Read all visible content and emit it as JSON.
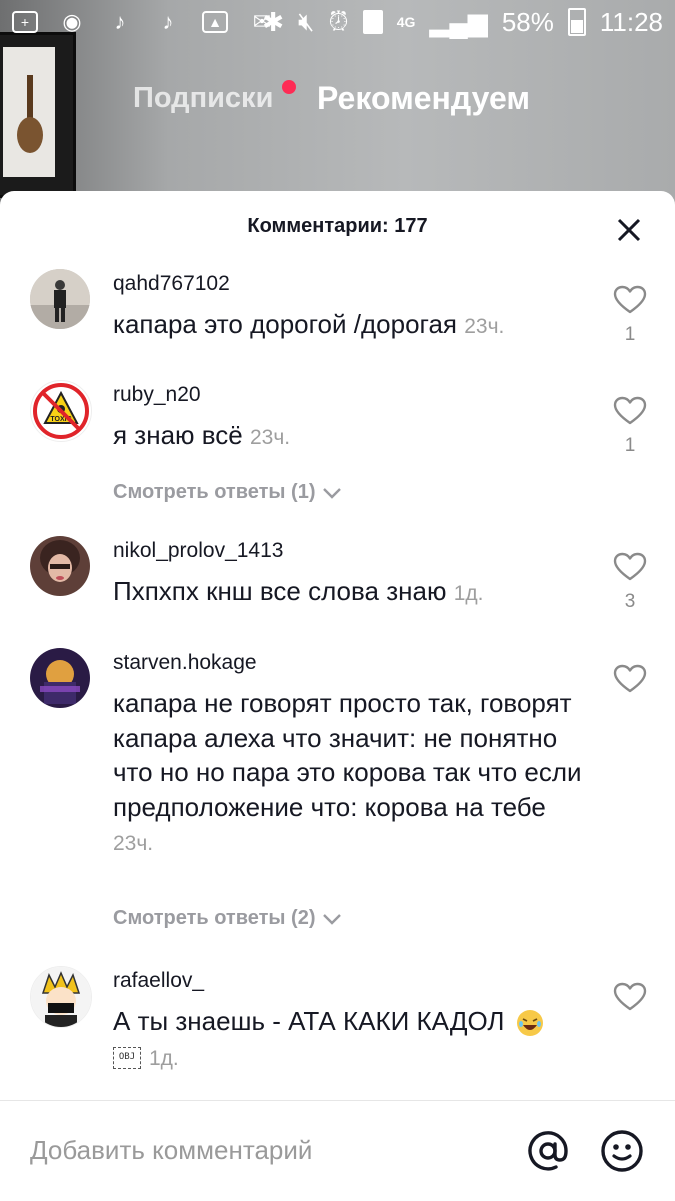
{
  "status_bar": {
    "network": "4G",
    "battery_percent": "58%",
    "time": "11:28",
    "sim_slot": "1"
  },
  "top_tabs": {
    "following": "Подписки",
    "for_you": "Рекомендуем"
  },
  "comments_panel": {
    "title": "Комментарии: 177",
    "input_placeholder": "Добавить комментарий",
    "comments": [
      {
        "username": "qahd767102",
        "text": "капара это дорогой /дорогая",
        "time": "23ч.",
        "likes": "1"
      },
      {
        "username": "ruby_n20",
        "text": "я знаю всё",
        "time": "23ч.",
        "likes": "1",
        "replies_label": "Смотреть ответы (1)"
      },
      {
        "username": "nikol_prolov_1413",
        "text": "Пхпхпх кнш все слова знаю",
        "time": "1д.",
        "likes": "3"
      },
      {
        "username": "starven.hokage",
        "text": "капара не говорят просто так, говорят капара алеха что значит: не понятно что но но пара это корова так что если предположение что: корова на тебе",
        "time": "23ч.",
        "likes": "",
        "replies_label": "Смотреть ответы (2)"
      },
      {
        "username": "rafaellov_",
        "text": "А ты знаешь - АТА КАКИ КАДОЛ",
        "time": "1д.",
        "likes": "",
        "obj_label": "OBJ"
      }
    ]
  },
  "colors": {
    "accent_dot": "#fe2c55",
    "text_primary": "#161823",
    "text_muted": "#9e9e9e"
  }
}
